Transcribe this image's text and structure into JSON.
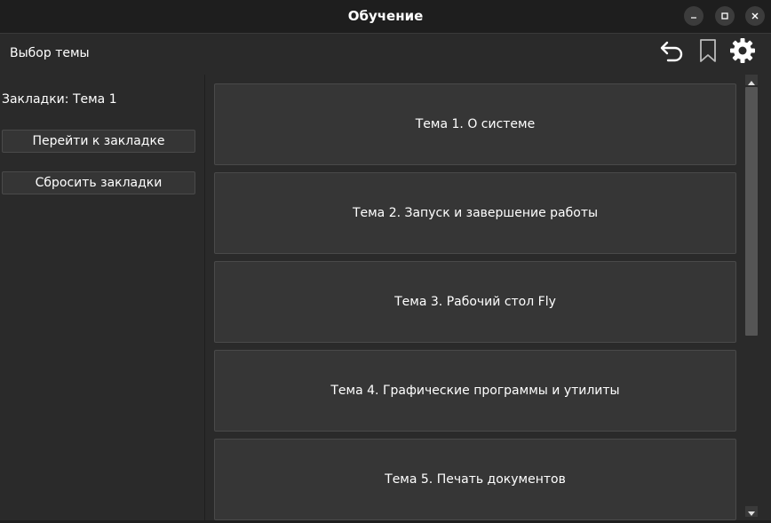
{
  "window": {
    "title": "Обучение",
    "controls": [
      "minimize-icon",
      "maximize-icon",
      "close-icon"
    ]
  },
  "toolbar": {
    "section_title": "Выбор темы",
    "icons": [
      "back-arrow-icon",
      "bookmark-icon",
      "gear-icon"
    ]
  },
  "left_panel": {
    "bookmark_label": "Закладки: Тема 1",
    "goto_button": "Перейти к закладке",
    "reset_button": "Сбросить закладки"
  },
  "topics": [
    "Тема 1. О системе",
    "Тема 2. Запуск и завершение работы",
    "Тема 3. Рабочий стол Fly",
    "Тема 4. Графические программы и утилиты",
    "Тема 5. Печать документов"
  ],
  "colors": {
    "background": "#2a2a2a",
    "titlebar": "#1e1e1e",
    "topic_card": "#363636",
    "text": "#ffffff"
  }
}
